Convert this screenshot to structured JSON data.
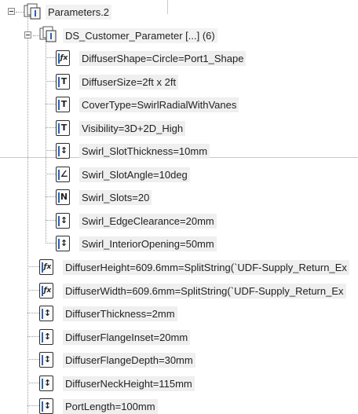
{
  "tree": {
    "root": {
      "label": "Parameters.2",
      "icon": "parameters-set-icon"
    },
    "group": {
      "label": "DS_Customer_Parameter [...] (6)",
      "icon": "parameter-set-icon"
    },
    "children": [
      {
        "label": "DiffuserShape=Circle=Port1_Shape",
        "icon": "formula-string-parameter-icon"
      },
      {
        "label": "DiffuserSize=2ft x 2ft",
        "icon": "string-parameter-icon"
      },
      {
        "label": "CoverType=SwirlRadialWithVanes",
        "icon": "string-parameter-icon"
      },
      {
        "label": "Visibility=3D+2D_High",
        "icon": "string-parameter-icon"
      },
      {
        "label": "Swirl_SlotThickness=10mm",
        "icon": "length-parameter-icon"
      },
      {
        "label": "Swirl_SlotAngle=10deg",
        "icon": "angle-parameter-icon"
      },
      {
        "label": "Swirl_Slots=20",
        "icon": "integer-parameter-icon"
      },
      {
        "label": "Swirl_EdgeClearance=20mm",
        "icon": "length-parameter-icon"
      },
      {
        "label": "Swirl_InteriorOpening=50mm",
        "icon": "length-parameter-icon"
      }
    ],
    "params": [
      {
        "label": "DiffuserHeight=609.6mm=SplitString(`UDF-Supply_Return_Ex",
        "icon": "formula-length-parameter-icon"
      },
      {
        "label": "DiffuserWidth=609.6mm=SplitString(`UDF-Supply_Return_Ex",
        "icon": "formula-length-parameter-icon"
      },
      {
        "label": "DiffuserThickness=2mm",
        "icon": "length-parameter-icon"
      },
      {
        "label": "DiffuserFlangeInset=20mm",
        "icon": "length-parameter-icon"
      },
      {
        "label": "DiffuserFlangeDepth=30mm",
        "icon": "length-parameter-icon"
      },
      {
        "label": "DiffuserNeckHeight=115mm",
        "icon": "length-parameter-icon"
      },
      {
        "label": "PortLength=100mm",
        "icon": "length-parameter-icon"
      }
    ]
  },
  "colors": {
    "accent": "#2b62b0",
    "label_bg": "#efefef"
  },
  "glyphs": {
    "string": "T",
    "angle": "∠",
    "integer": "N",
    "length": "↕",
    "formula": "ƒx"
  }
}
